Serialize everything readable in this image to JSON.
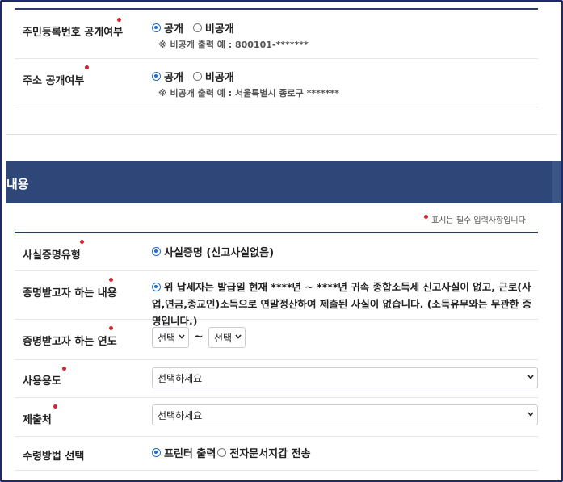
{
  "section1": {
    "rows": [
      {
        "label": "주민등록번호 공개여부",
        "options": [
          "공개",
          "비공개"
        ],
        "selected": 0,
        "note": "※ 비공개 출력 예 : 800101-*******"
      },
      {
        "label": "주소 공개여부",
        "options": [
          "공개",
          "비공개"
        ],
        "selected": 0,
        "note": "※ 비공개 출력 예 : 서울특별시 종로구 *******"
      }
    ]
  },
  "section2": {
    "title": "내용",
    "legend": "표시는 필수 입력사항입니다.",
    "proof_type": {
      "label": "사실증명유형",
      "option": "사실증명 (신고사실없음)"
    },
    "content": {
      "label": "증명받고자 하는 내용",
      "text": "위 납세자는 발급일 현재 ****년 ~ ****년 귀속 종합소득세 신고사실이 없고, 근로(사업,연금,종교인)소득으로 연말정산하여 제출된 사실이 없습니다. (소득유무와는 무관한 증명입니다.)"
    },
    "year": {
      "label": "증명받고자 하는 연도",
      "from": "선택",
      "tilde": "~",
      "to": "선택"
    },
    "usage": {
      "label": "사용용도",
      "value": "선택하세요"
    },
    "submit_to": {
      "label": "제출처",
      "value": "선택하세요"
    },
    "receive": {
      "label": "수령방법 선택",
      "options": [
        "프린터 출력",
        "전자문서지갑 전송"
      ],
      "selected": 0
    }
  },
  "colors": {
    "banner": "#2e4778",
    "required_dot": "#d0262f",
    "radio_on": "#1d6fd6",
    "frame": "#1f2a6b"
  }
}
